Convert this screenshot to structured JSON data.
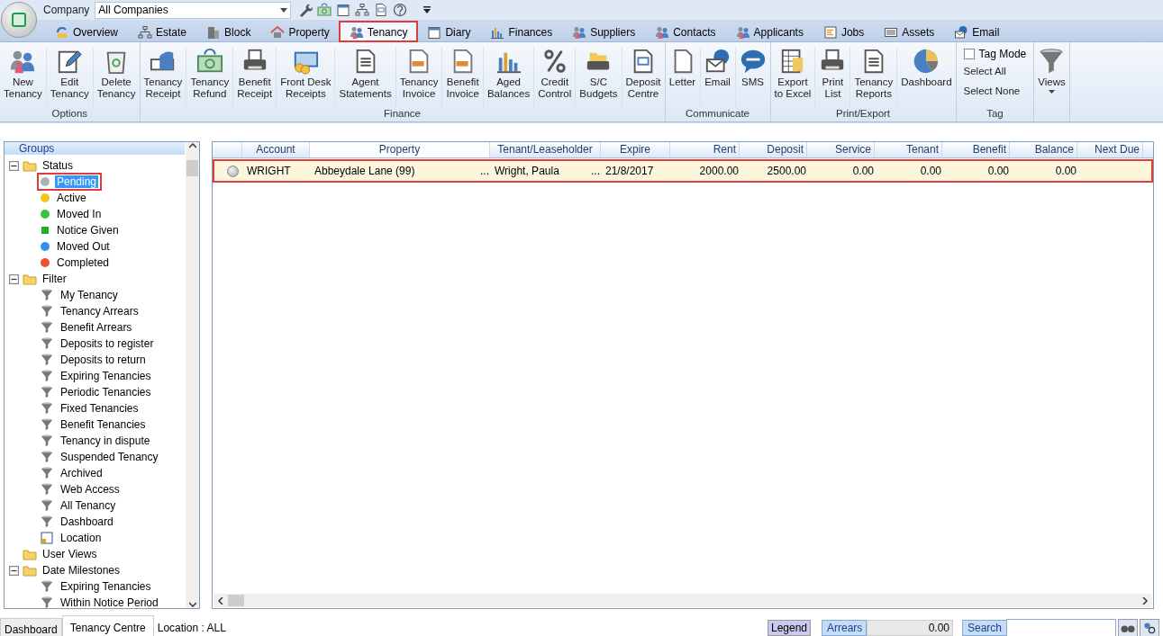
{
  "company": {
    "label": "Company",
    "value": "All Companies"
  },
  "tabs": [
    {
      "label": "Overview",
      "selected": false,
      "highlighted": false
    },
    {
      "label": "Estate",
      "selected": false,
      "highlighted": false
    },
    {
      "label": "Block",
      "selected": false,
      "highlighted": false
    },
    {
      "label": "Property",
      "selected": false,
      "highlighted": false
    },
    {
      "label": "Tenancy",
      "selected": true,
      "highlighted": true
    },
    {
      "label": "Diary",
      "selected": false,
      "highlighted": false
    },
    {
      "label": "Finances",
      "selected": false,
      "highlighted": false
    },
    {
      "label": "Suppliers",
      "selected": false,
      "highlighted": false
    },
    {
      "label": "Contacts",
      "selected": false,
      "highlighted": false
    },
    {
      "label": "Applicants",
      "selected": false,
      "highlighted": false
    },
    {
      "label": "Jobs",
      "selected": false,
      "highlighted": false
    },
    {
      "label": "Assets",
      "selected": false,
      "highlighted": false
    },
    {
      "label": "Email",
      "selected": false,
      "highlighted": false
    }
  ],
  "ribbon_groups": [
    {
      "label": "Options",
      "items": [
        {
          "kind": "button",
          "label": "New\nTenancy"
        },
        {
          "kind": "button",
          "label": "Edit\nTenancy"
        },
        {
          "kind": "button",
          "label": "Delete\nTenancy"
        }
      ]
    },
    {
      "label": "Finance",
      "items": [
        {
          "kind": "button",
          "label": "Tenancy\nReceipt"
        },
        {
          "kind": "button",
          "label": "Tenancy\nRefund"
        },
        {
          "kind": "button",
          "label": "Benefit\nReceipt"
        },
        {
          "kind": "button",
          "label": "Front Desk\nReceipts"
        },
        {
          "kind": "button",
          "label": "Agent\nStatements"
        },
        {
          "kind": "button",
          "label": "Tenancy\nInvoice"
        },
        {
          "kind": "button",
          "label": "Benefit\nInvoice"
        },
        {
          "kind": "button",
          "label": "Aged\nBalances"
        },
        {
          "kind": "button",
          "label": "Credit\nControl"
        },
        {
          "kind": "button",
          "label": "S/C\nBudgets"
        },
        {
          "kind": "button",
          "label": "Deposit\nCentre"
        }
      ]
    },
    {
      "label": "Communicate",
      "items": [
        {
          "kind": "button",
          "label": "Letter"
        },
        {
          "kind": "button",
          "label": "Email"
        },
        {
          "kind": "button",
          "label": "SMS"
        }
      ]
    },
    {
      "label": "Print/Export",
      "items": [
        {
          "kind": "button",
          "label": "Export\nto Excel"
        },
        {
          "kind": "button",
          "label": "Print\nList"
        },
        {
          "kind": "button",
          "label": "Tenancy\nReports"
        },
        {
          "kind": "button",
          "label": "Dashboard"
        }
      ]
    },
    {
      "label": "Tag",
      "items": [
        {
          "kind": "checkbox",
          "label": "Tag Mode",
          "checked": false
        },
        {
          "kind": "link",
          "label": "Select All"
        },
        {
          "kind": "link",
          "label": "Select None"
        }
      ]
    },
    {
      "items": [
        {
          "kind": "dropdown",
          "label": "Views"
        }
      ]
    }
  ],
  "sidebar": {
    "title": "Groups",
    "tree": [
      {
        "label": "Status",
        "expanded": true,
        "children": [
          {
            "kind": "status",
            "label": "Pending",
            "color": "#a9b3b3",
            "selected": true,
            "highlighted": true
          },
          {
            "kind": "status",
            "label": "Active",
            "color": "#f5c518",
            "selected": false,
            "highlighted": false
          },
          {
            "kind": "status",
            "label": "Moved In",
            "color": "#3cc13c",
            "selected": false,
            "highlighted": false
          },
          {
            "kind": "square",
            "label": "Notice Given",
            "color": "#22b022",
            "selected": false,
            "highlighted": false
          },
          {
            "kind": "status",
            "label": "Moved Out",
            "color": "#2f93ea",
            "selected": false,
            "highlighted": false
          },
          {
            "kind": "status",
            "label": "Completed",
            "color": "#f0502a",
            "selected": false,
            "highlighted": false
          }
        ]
      },
      {
        "label": "Filter",
        "expanded": true,
        "children": [
          {
            "kind": "filter",
            "label": "My Tenancy",
            "selected": false,
            "highlighted": false
          },
          {
            "kind": "filter",
            "label": "Tenancy Arrears",
            "selected": false,
            "highlighted": false
          },
          {
            "kind": "filter",
            "label": "Benefit Arrears",
            "selected": false,
            "highlighted": false
          },
          {
            "kind": "filter",
            "label": "Deposits to register",
            "selected": false,
            "highlighted": false
          },
          {
            "kind": "filter",
            "label": "Deposits to return",
            "selected": false,
            "highlighted": false
          },
          {
            "kind": "filter",
            "label": "Expiring Tenancies",
            "selected": false,
            "highlighted": false
          },
          {
            "kind": "filter",
            "label": "Periodic Tenancies",
            "selected": false,
            "highlighted": false
          },
          {
            "kind": "filter",
            "label": "Fixed Tenancies",
            "selected": false,
            "highlighted": false
          },
          {
            "kind": "filter",
            "label": "Benefit Tenancies",
            "selected": false,
            "highlighted": false
          },
          {
            "kind": "filter",
            "label": "Tenancy in dispute",
            "selected": false,
            "highlighted": false
          },
          {
            "kind": "filter",
            "label": "Suspended Tenancy",
            "selected": false,
            "highlighted": false
          },
          {
            "kind": "filter",
            "label": "Archived",
            "selected": false,
            "highlighted": false
          },
          {
            "kind": "filter",
            "label": "Web Access",
            "selected": false,
            "highlighted": false
          },
          {
            "kind": "filter",
            "label": "All Tenancy",
            "selected": false,
            "highlighted": false
          },
          {
            "kind": "filter",
            "label": "Dashboard",
            "selected": false,
            "highlighted": false
          },
          {
            "kind": "location",
            "label": "Location",
            "selected": false,
            "highlighted": false
          }
        ]
      },
      {
        "label": "User Views"
      },
      {
        "label": "Date Milestones",
        "expanded": true,
        "children": [
          {
            "kind": "filter",
            "label": "Expiring Tenancies",
            "selected": false,
            "highlighted": false
          },
          {
            "kind": "filter",
            "label": "Within Notice Period",
            "selected": false,
            "highlighted": false
          }
        ]
      }
    ]
  },
  "table": {
    "columns": [
      {
        "label": "Account",
        "sorted": false
      },
      {
        "label": "Property",
        "sorted": true
      },
      {
        "label": "Tenant/Leaseholder",
        "sorted": false
      },
      {
        "label": "Expire",
        "sorted": false
      },
      {
        "label": "Rent",
        "sorted": false
      },
      {
        "label": "Deposit",
        "sorted": false
      },
      {
        "label": "Service",
        "sorted": false
      },
      {
        "label": "Tenant",
        "sorted": false
      },
      {
        "label": "Benefit",
        "sorted": false
      },
      {
        "label": "Balance",
        "sorted": false
      },
      {
        "label": "Next Due",
        "sorted": false
      }
    ],
    "rows": [
      {
        "selected": true,
        "highlighted": true,
        "cells": [
          {
            "text": "WRIGHT"
          },
          {
            "text": "Abbeydale Lane (99)",
            "more": "..."
          },
          {
            "text": "Wright, Paula",
            "more": "..."
          },
          {
            "text": "21/8/2017"
          },
          {
            "text": "2000.00"
          },
          {
            "text": "2500.00"
          },
          {
            "text": "0.00"
          },
          {
            "text": "0.00"
          },
          {
            "text": "0.00"
          },
          {
            "text": "0.00"
          }
        ]
      }
    ]
  },
  "status_bar": {
    "tabs": [
      {
        "label": "Dashboard",
        "selected": false
      },
      {
        "label": "Tenancy Centre",
        "selected": true
      }
    ],
    "location": "Location : ALL",
    "legend": "Legend",
    "arrears_label": "Arrears",
    "arrears_value": "0.00",
    "search_label": "Search"
  }
}
